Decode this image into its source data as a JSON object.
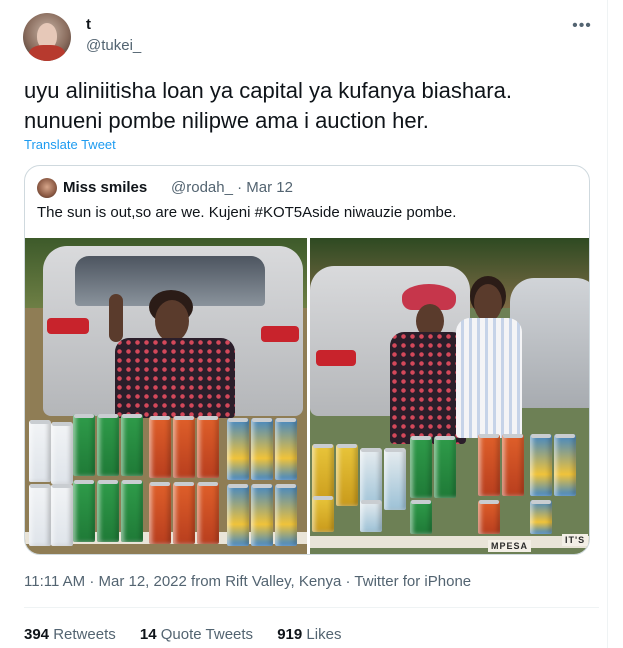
{
  "author": {
    "display_name": "t",
    "handle": "@tukei_"
  },
  "tweet": {
    "text": "uyu aliniitisha loan ya capital ya kufanya biashara.\nnunueni pombe nilipwe ama i auction her.",
    "translate_label": "Translate Tweet"
  },
  "quoted_tweet": {
    "display_name": "Miss smiles",
    "handle": "@rodah_",
    "separator": "·",
    "date": "Mar 12",
    "text": "The sun is out,so are we. Kujeni #KOT5Aside niwauzie pombe.",
    "sign_left": "MPESA",
    "sign_right": "IT'S"
  },
  "meta": {
    "timestamp": "11:11 AM · Mar 12, 2022 from Rift Valley, Kenya · Twitter for iPhone"
  },
  "stats": {
    "retweets_count": "394",
    "retweets_label": "Retweets",
    "quotes_count": "14",
    "quotes_label": "Quote Tweets",
    "likes_count": "919",
    "likes_label": "Likes"
  },
  "colors": {
    "link": "#1d9bf0",
    "secondary_text": "#536471",
    "border": "#cfd9de"
  },
  "icons": {
    "more": "more-horizontal-icon"
  }
}
